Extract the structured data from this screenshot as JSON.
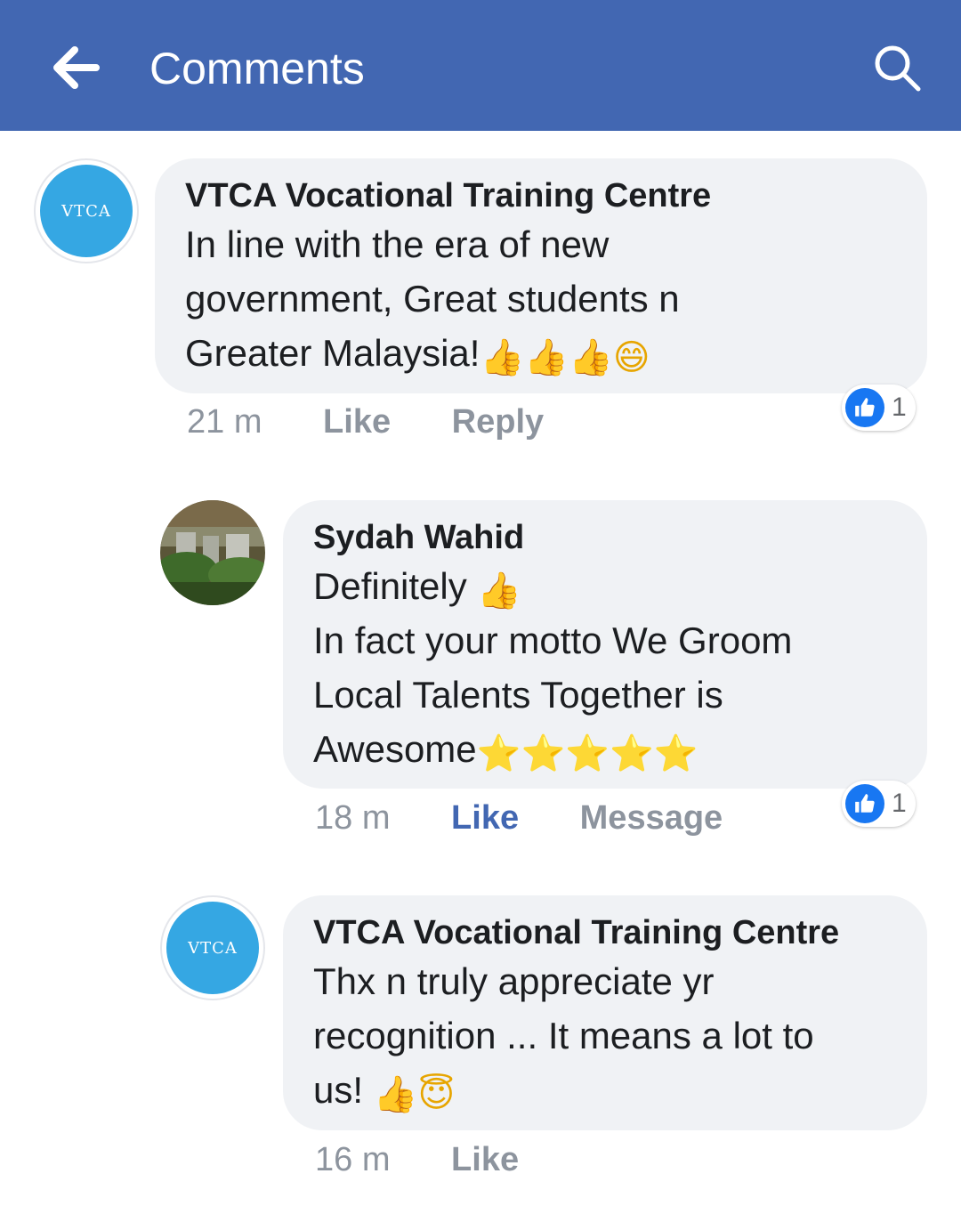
{
  "header": {
    "title": "Comments",
    "back_icon": "arrow-left-icon",
    "search_icon": "search-icon",
    "background": "#4267b2"
  },
  "comments": [
    {
      "author": "VTCA Vocational Training Centre",
      "avatar_text": "VTCA",
      "lines": [
        "In line with the era of new",
        "government, Great students n",
        "Greater Malaysia!"
      ],
      "emojis": [
        "👍",
        "👍",
        "👍",
        "😄"
      ],
      "time": "21 m",
      "actions": [
        "Like",
        "Reply"
      ],
      "reaction_count": "1"
    },
    {
      "author": "Sydah Wahid",
      "lines": [
        "Definitely",
        "In fact your motto We Groom",
        "Local Talents Together is",
        "Awesome"
      ],
      "emojis_line1": [
        "👍"
      ],
      "emojis_last": [
        "⭐",
        "⭐",
        "⭐",
        "⭐",
        "⭐"
      ],
      "time": "18 m",
      "actions": [
        "Like",
        "Message"
      ],
      "reaction_count": "1"
    },
    {
      "author": "VTCA Vocational Training Centre",
      "avatar_text": "VTCA",
      "lines": [
        "Thx n truly appreciate yr",
        "recognition ... It means a lot to",
        "us!"
      ],
      "emojis": [
        "👍",
        "😇"
      ],
      "time": "16 m",
      "actions": [
        "Like"
      ]
    }
  ]
}
